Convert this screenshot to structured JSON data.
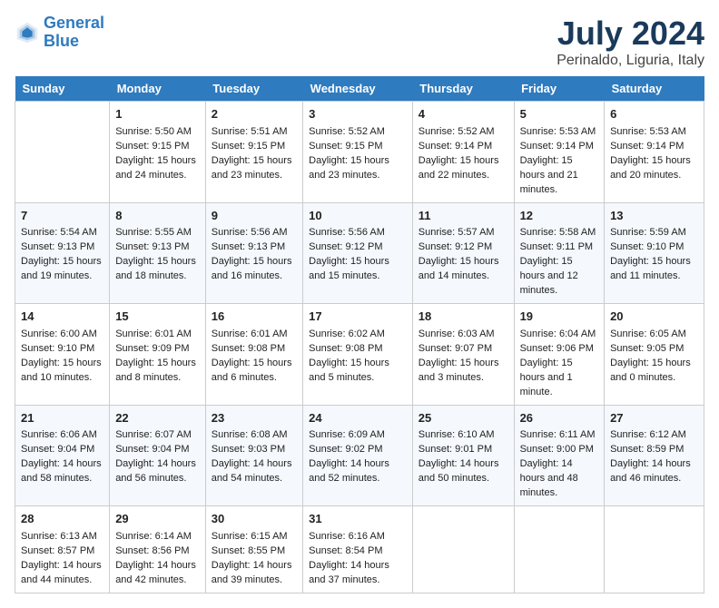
{
  "header": {
    "logo_line1": "General",
    "logo_line2": "Blue",
    "title": "July 2024",
    "subtitle": "Perinaldo, Liguria, Italy"
  },
  "days_of_week": [
    "Sunday",
    "Monday",
    "Tuesday",
    "Wednesday",
    "Thursday",
    "Friday",
    "Saturday"
  ],
  "weeks": [
    [
      {
        "day": "",
        "empty": true
      },
      {
        "day": "1",
        "sunrise": "5:50 AM",
        "sunset": "9:15 PM",
        "daylight": "15 hours and 24 minutes."
      },
      {
        "day": "2",
        "sunrise": "5:51 AM",
        "sunset": "9:15 PM",
        "daylight": "15 hours and 23 minutes."
      },
      {
        "day": "3",
        "sunrise": "5:52 AM",
        "sunset": "9:15 PM",
        "daylight": "15 hours and 23 minutes."
      },
      {
        "day": "4",
        "sunrise": "5:52 AM",
        "sunset": "9:14 PM",
        "daylight": "15 hours and 22 minutes."
      },
      {
        "day": "5",
        "sunrise": "5:53 AM",
        "sunset": "9:14 PM",
        "daylight": "15 hours and 21 minutes."
      },
      {
        "day": "6",
        "sunrise": "5:53 AM",
        "sunset": "9:14 PM",
        "daylight": "15 hours and 20 minutes."
      }
    ],
    [
      {
        "day": "7",
        "sunrise": "5:54 AM",
        "sunset": "9:13 PM",
        "daylight": "15 hours and 19 minutes."
      },
      {
        "day": "8",
        "sunrise": "5:55 AM",
        "sunset": "9:13 PM",
        "daylight": "15 hours and 18 minutes."
      },
      {
        "day": "9",
        "sunrise": "5:56 AM",
        "sunset": "9:13 PM",
        "daylight": "15 hours and 16 minutes."
      },
      {
        "day": "10",
        "sunrise": "5:56 AM",
        "sunset": "9:12 PM",
        "daylight": "15 hours and 15 minutes."
      },
      {
        "day": "11",
        "sunrise": "5:57 AM",
        "sunset": "9:12 PM",
        "daylight": "15 hours and 14 minutes."
      },
      {
        "day": "12",
        "sunrise": "5:58 AM",
        "sunset": "9:11 PM",
        "daylight": "15 hours and 12 minutes."
      },
      {
        "day": "13",
        "sunrise": "5:59 AM",
        "sunset": "9:10 PM",
        "daylight": "15 hours and 11 minutes."
      }
    ],
    [
      {
        "day": "14",
        "sunrise": "6:00 AM",
        "sunset": "9:10 PM",
        "daylight": "15 hours and 10 minutes."
      },
      {
        "day": "15",
        "sunrise": "6:01 AM",
        "sunset": "9:09 PM",
        "daylight": "15 hours and 8 minutes."
      },
      {
        "day": "16",
        "sunrise": "6:01 AM",
        "sunset": "9:08 PM",
        "daylight": "15 hours and 6 minutes."
      },
      {
        "day": "17",
        "sunrise": "6:02 AM",
        "sunset": "9:08 PM",
        "daylight": "15 hours and 5 minutes."
      },
      {
        "day": "18",
        "sunrise": "6:03 AM",
        "sunset": "9:07 PM",
        "daylight": "15 hours and 3 minutes."
      },
      {
        "day": "19",
        "sunrise": "6:04 AM",
        "sunset": "9:06 PM",
        "daylight": "15 hours and 1 minute."
      },
      {
        "day": "20",
        "sunrise": "6:05 AM",
        "sunset": "9:05 PM",
        "daylight": "15 hours and 0 minutes."
      }
    ],
    [
      {
        "day": "21",
        "sunrise": "6:06 AM",
        "sunset": "9:04 PM",
        "daylight": "14 hours and 58 minutes."
      },
      {
        "day": "22",
        "sunrise": "6:07 AM",
        "sunset": "9:04 PM",
        "daylight": "14 hours and 56 minutes."
      },
      {
        "day": "23",
        "sunrise": "6:08 AM",
        "sunset": "9:03 PM",
        "daylight": "14 hours and 54 minutes."
      },
      {
        "day": "24",
        "sunrise": "6:09 AM",
        "sunset": "9:02 PM",
        "daylight": "14 hours and 52 minutes."
      },
      {
        "day": "25",
        "sunrise": "6:10 AM",
        "sunset": "9:01 PM",
        "daylight": "14 hours and 50 minutes."
      },
      {
        "day": "26",
        "sunrise": "6:11 AM",
        "sunset": "9:00 PM",
        "daylight": "14 hours and 48 minutes."
      },
      {
        "day": "27",
        "sunrise": "6:12 AM",
        "sunset": "8:59 PM",
        "daylight": "14 hours and 46 minutes."
      }
    ],
    [
      {
        "day": "28",
        "sunrise": "6:13 AM",
        "sunset": "8:57 PM",
        "daylight": "14 hours and 44 minutes."
      },
      {
        "day": "29",
        "sunrise": "6:14 AM",
        "sunset": "8:56 PM",
        "daylight": "14 hours and 42 minutes."
      },
      {
        "day": "30",
        "sunrise": "6:15 AM",
        "sunset": "8:55 PM",
        "daylight": "14 hours and 39 minutes."
      },
      {
        "day": "31",
        "sunrise": "6:16 AM",
        "sunset": "8:54 PM",
        "daylight": "14 hours and 37 minutes."
      },
      {
        "day": "",
        "empty": true
      },
      {
        "day": "",
        "empty": true
      },
      {
        "day": "",
        "empty": true
      }
    ]
  ]
}
